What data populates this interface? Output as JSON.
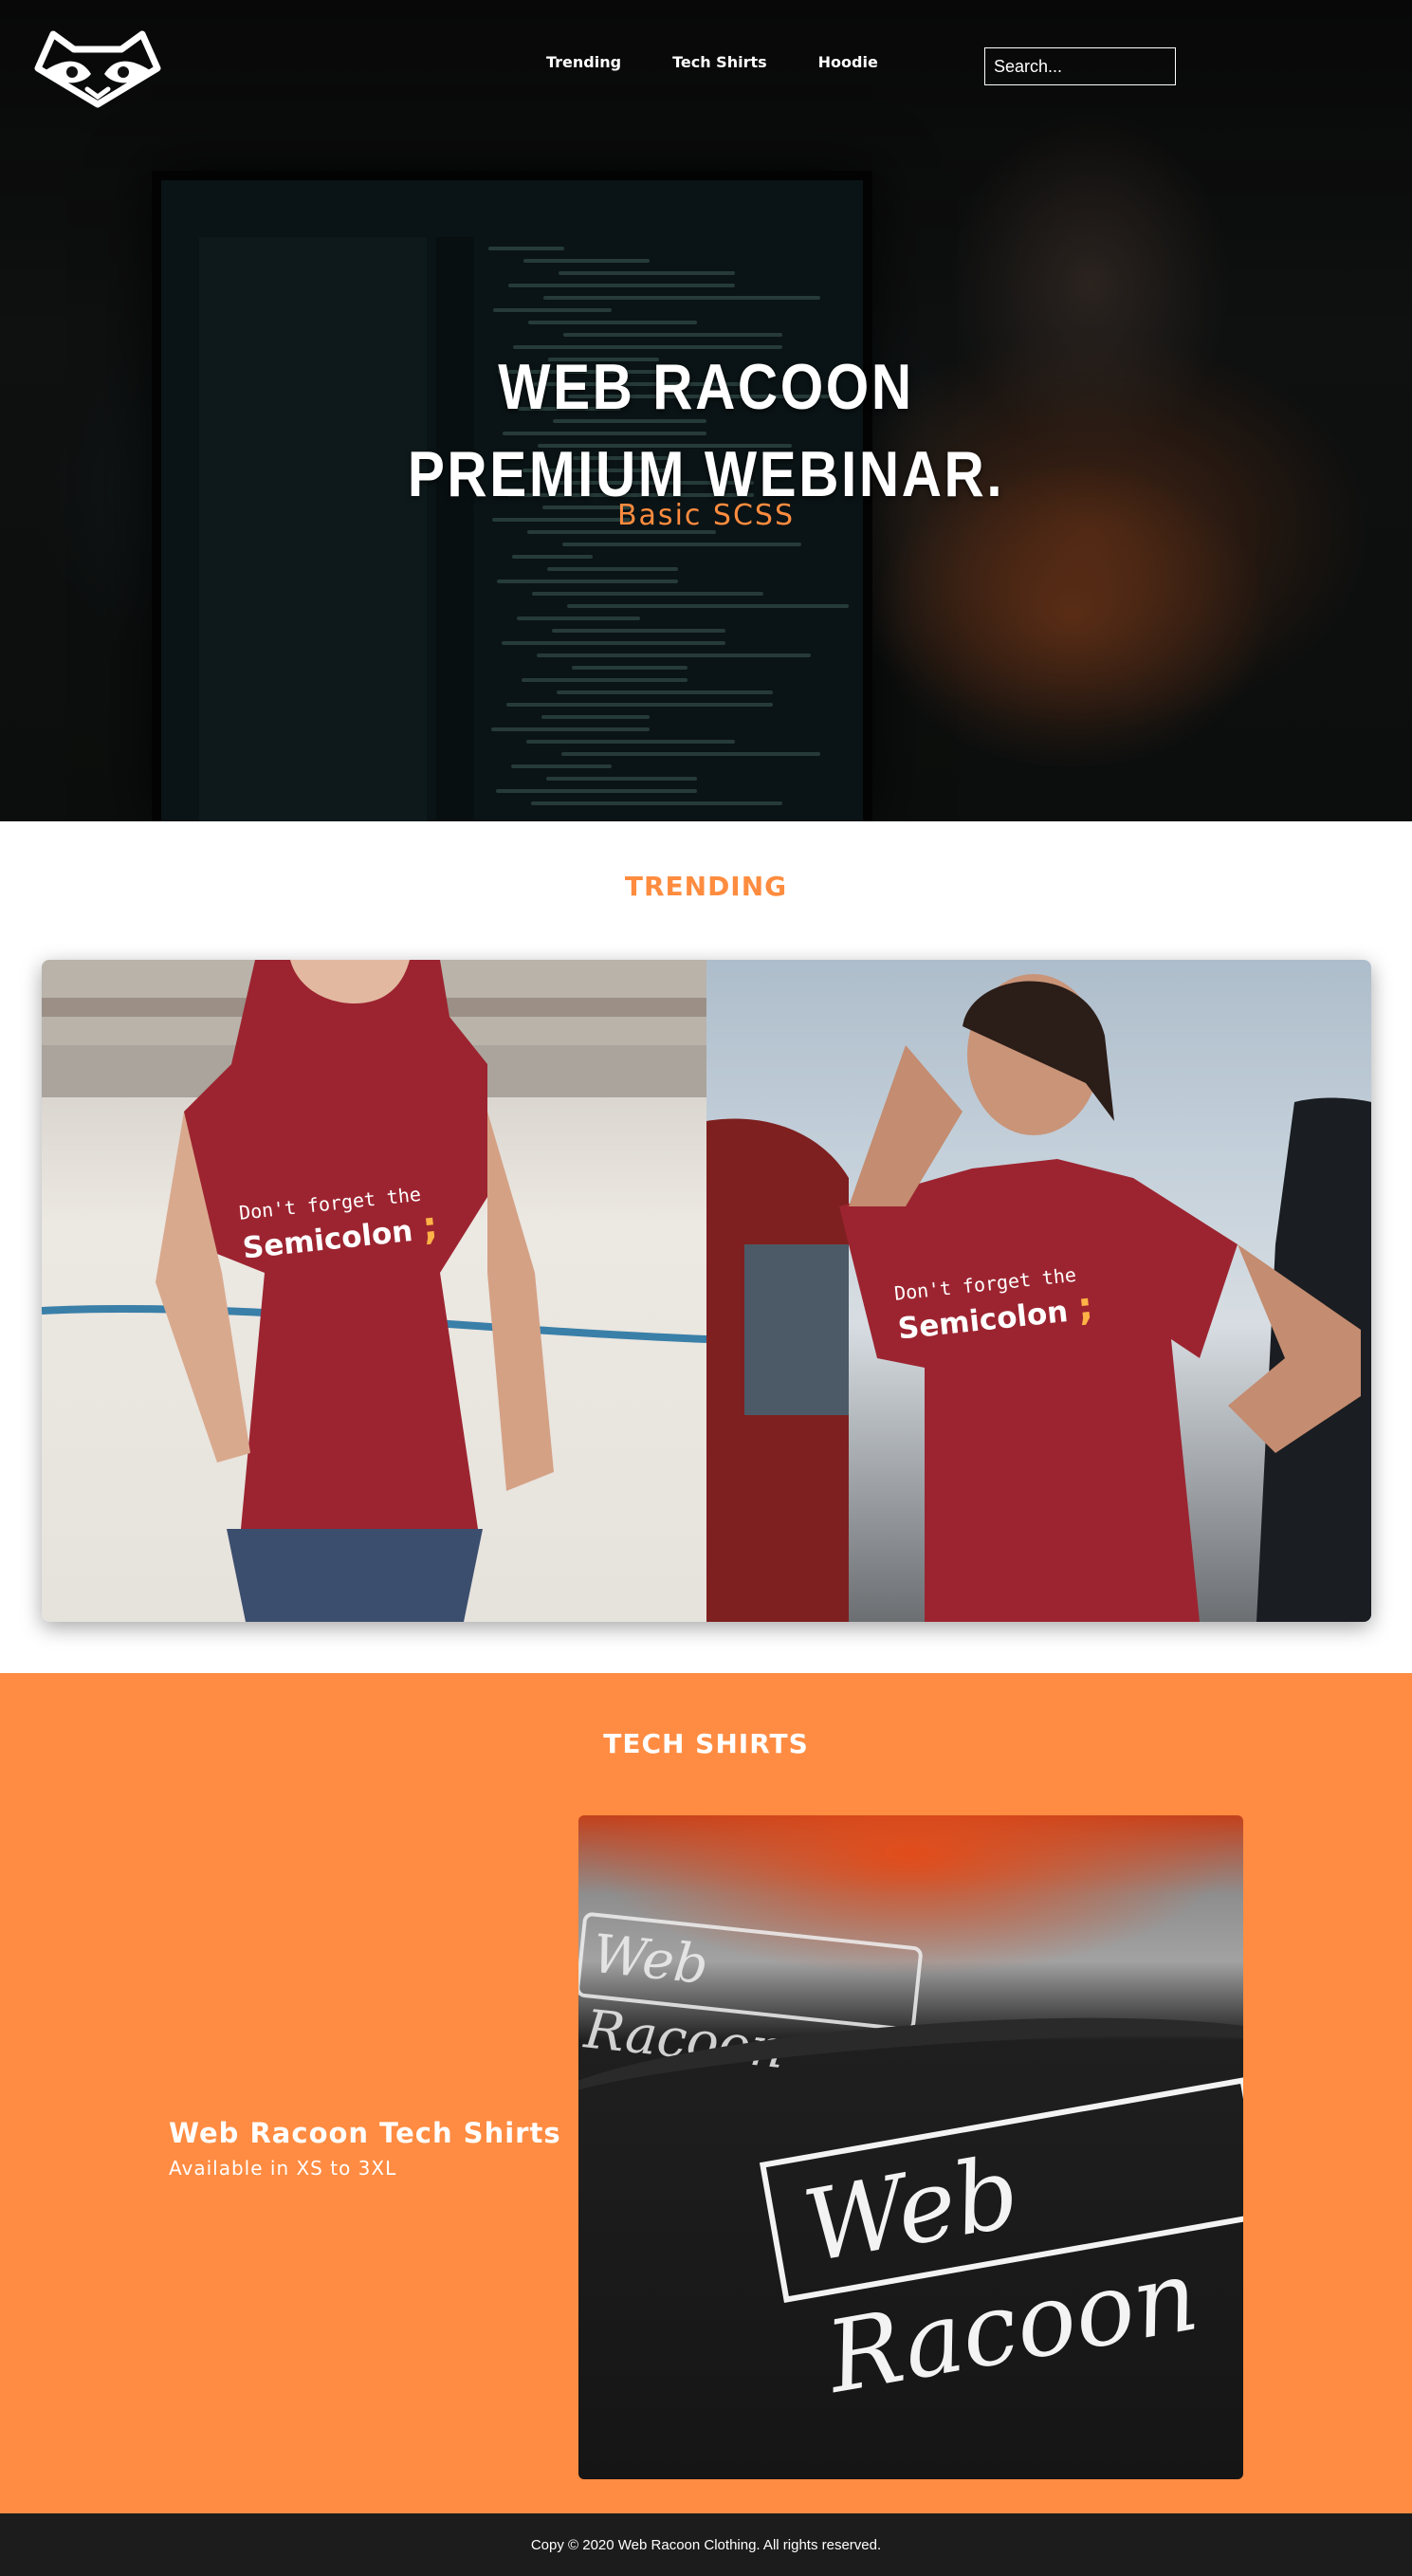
{
  "header": {
    "logo_icon": "raccoon-mask-icon",
    "nav": [
      {
        "label": "Trending"
      },
      {
        "label": "Tech Shirts"
      },
      {
        "label": "Hoodie"
      }
    ],
    "search": {
      "placeholder": "Search...",
      "value": ""
    }
  },
  "hero": {
    "title_line1": "WEB RACOON",
    "title_line2": "PREMIUM WEBINAR.",
    "subtitle": "Basic SCSS"
  },
  "trending": {
    "title": "TRENDING",
    "shirt_print": {
      "line1": "Don't forget the",
      "line2": "Semicolon",
      "symbol": ";"
    }
  },
  "tech_shirts": {
    "title": "TECH SHIRTS",
    "heading": "Web Racoon Tech Shirts",
    "caption": "Available in XS to 3XL",
    "label_print": "Web Racoon"
  },
  "footer": {
    "text": "Copy © 2020 Web Racoon Clothing. All rights reserved."
  },
  "colors": {
    "accent": "#ff8c42",
    "footer_bg": "#1c1c1c",
    "text_light": "#ffffff"
  }
}
